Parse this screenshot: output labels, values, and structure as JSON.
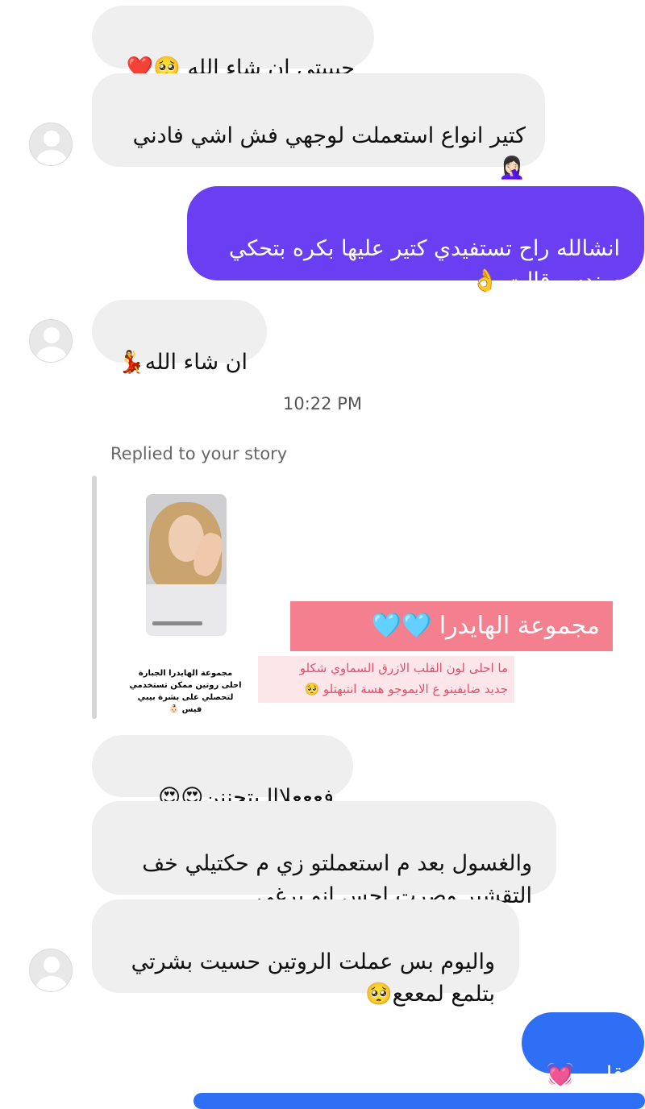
{
  "messages": [
    {
      "text": "حبيبتي ان شاء الله 🥺❤️",
      "direction": "received"
    },
    {
      "text": "كتير انواع استعملت لوجهي فش اشي فادني\n🤦🏻‍♀️",
      "direction": "received"
    },
    {
      "text": "انشالله راح تستفيدي كتير عليها بكره بتحكي\nسندس قالت 👌",
      "direction": "sent"
    },
    {
      "text": "ان شاء الله💃",
      "direction": "received"
    },
    {
      "text": "فعععلااا بتجننن😍😍",
      "direction": "received"
    },
    {
      "text": "والغسول بعد م استعملتو زي م حكتيلي خف\nالتقشبر وصرت احس انو برغي",
      "direction": "received"
    },
    {
      "text": "واليوم بس عملت الروتين حسيت بشرتي\nبتلمع لمععع🥺",
      "direction": "received"
    },
    {
      "text": "قلبي 💓",
      "direction": "sent"
    }
  ],
  "timestamp": "10:22 PM",
  "story_reply": {
    "label": "Replied to your story",
    "story_caption": "مجموعة الهايدرا الجبارة احلى روتين ممكن تستخدمي لتحصلي على بشرة بيبي فيس 👶🏻",
    "title": "مجموعة الهايدرا 🩵🩵",
    "note": "ما احلى لون القلب الازرق السماوي شكلو\nجديد ضايفينو ع الايموجو هسة انتبهتلو 🥺"
  },
  "colors": {
    "received_bubble": "#efefef",
    "sent_bubble_purple": "#6a3ff2",
    "sent_bubble_blue": "#2f6ff6",
    "pink_title_bg": "#f37f8f",
    "pink_note_bg": "#fde6ea"
  }
}
